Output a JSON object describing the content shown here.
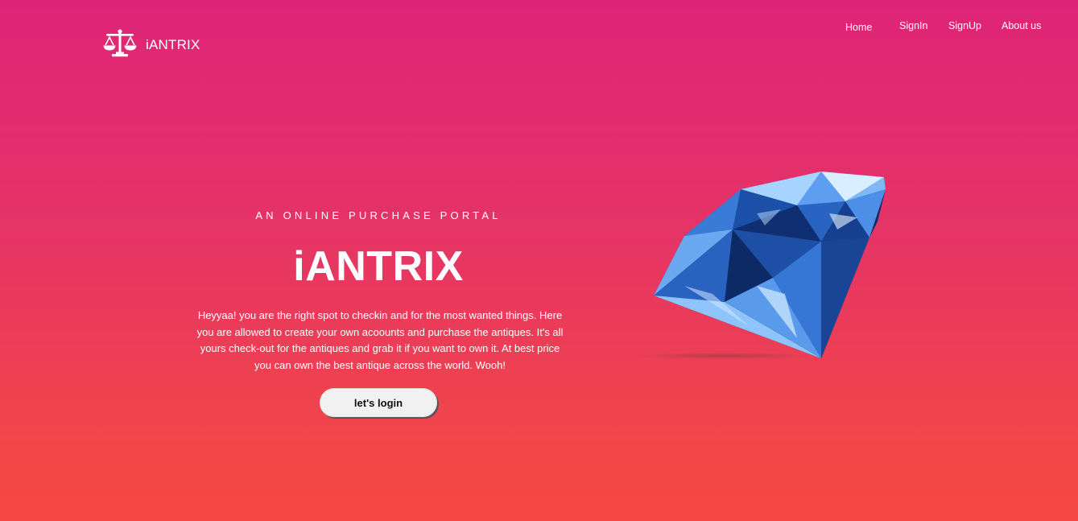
{
  "brand": {
    "name": "iANTRIX",
    "logo_icon": "balance-scale-icon"
  },
  "nav": {
    "items": [
      {
        "label": "Home"
      },
      {
        "label": "SignIn"
      },
      {
        "label": "SignUp"
      },
      {
        "label": "About us"
      }
    ]
  },
  "hero": {
    "tagline": "AN ONLINE PURCHASE PORTAL",
    "title": "iANTRIX",
    "description": "Heyyaa! you are the right spot to checkin and for the most wanted things. Here you are allowed to create your own acoounts and purchase the antiques. It's all yours check-out for the antiques and grab it if you want to own it. At best price you can own the best antique across the world. Wooh!",
    "button_label": "let's login",
    "image_icon": "diamond-icon"
  },
  "colors": {
    "gradient_top": "#de2478",
    "gradient_bottom": "#f54842",
    "button_bg": "#f1f1f1",
    "diamond_blue": "#3d7fd6"
  }
}
